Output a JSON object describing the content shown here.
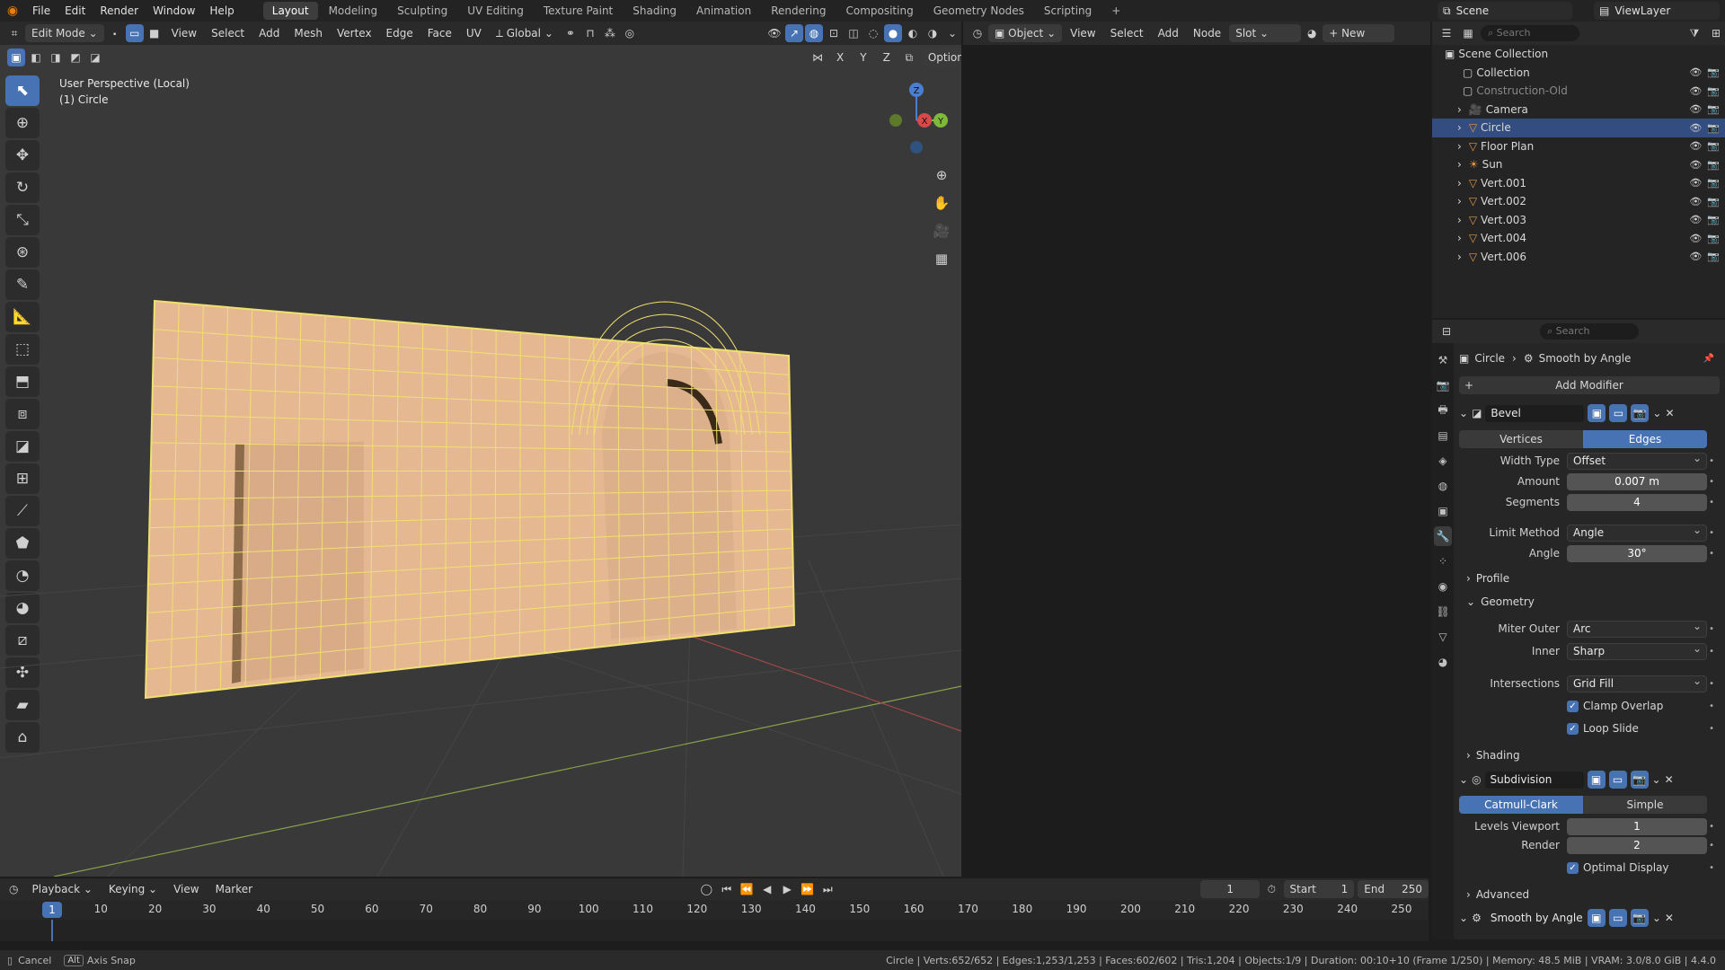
{
  "topbar": {
    "menus": [
      "File",
      "Edit",
      "Render",
      "Window",
      "Help"
    ],
    "workspaces": [
      "Layout",
      "Modeling",
      "Sculpting",
      "UV Editing",
      "Texture Paint",
      "Shading",
      "Animation",
      "Rendering",
      "Compositing",
      "Geometry Nodes",
      "Scripting"
    ],
    "active_workspace": "Layout",
    "scene": "Scene",
    "view_layer": "ViewLayer"
  },
  "viewport": {
    "mode": "Edit Mode",
    "menus": [
      "View",
      "Select",
      "Add",
      "Mesh",
      "Vertex",
      "Edge",
      "Face",
      "UV"
    ],
    "transform_orientation": "Global",
    "axes": [
      "X",
      "Y",
      "Z"
    ],
    "options_label": "Options",
    "perspective": "User Perspective (Local)",
    "object_label": "(1) Circle",
    "gizmo_labels": {
      "z": "Z",
      "x": "X",
      "y": "Y"
    },
    "accent": "#4772b3",
    "mesh_fill": "#e9b98f",
    "mesh_wire": "#f0e070"
  },
  "node_editor": {
    "mode": "Object",
    "menus": [
      "View",
      "Select",
      "Add",
      "Node"
    ],
    "slot": "Slot",
    "new_label": "New"
  },
  "outliner": {
    "search_placeholder": "Search",
    "root": "Scene Collection",
    "rows": [
      {
        "name": "Collection",
        "icon": "collection-icon",
        "selected": false
      },
      {
        "name": "Construction-Old",
        "icon": "collection-icon",
        "selected": false
      },
      {
        "name": "Camera",
        "icon": "camera-icon",
        "selected": false
      },
      {
        "name": "Circle",
        "icon": "mesh-icon",
        "selected": true
      },
      {
        "name": "Floor Plan",
        "icon": "mesh-icon",
        "selected": false
      },
      {
        "name": "Sun",
        "icon": "light-icon",
        "selected": false
      },
      {
        "name": "Vert.001",
        "icon": "mesh-icon",
        "selected": false
      },
      {
        "name": "Vert.002",
        "icon": "mesh-icon",
        "selected": false
      },
      {
        "name": "Vert.003",
        "icon": "mesh-icon",
        "selected": false
      },
      {
        "name": "Vert.004",
        "icon": "mesh-icon",
        "selected": false
      },
      {
        "name": "Vert.006",
        "icon": "mesh-icon",
        "selected": false
      }
    ]
  },
  "properties": {
    "search_placeholder": "Search",
    "breadcrumb_object": "Circle",
    "breadcrumb_modifier": "Smooth by Angle",
    "add_modifier": "Add Modifier",
    "bevel": {
      "name": "Bevel",
      "affect": [
        "Vertices",
        "Edges"
      ],
      "affect_active": "Edges",
      "width_type_label": "Width Type",
      "width_type": "Offset",
      "amount_label": "Amount",
      "amount": "0.007 m",
      "segments_label": "Segments",
      "segments": "4",
      "limit_method_label": "Limit Method",
      "limit_method": "Angle",
      "angle_label": "Angle",
      "angle": "30°",
      "profile": "Profile",
      "geometry": "Geometry",
      "miter_outer_label": "Miter Outer",
      "miter_outer": "Arc",
      "inner_label": "Inner",
      "inner": "Sharp",
      "intersections_label": "Intersections",
      "intersections": "Grid Fill",
      "clamp_overlap": "Clamp Overlap",
      "loop_slide": "Loop Slide",
      "shading": "Shading"
    },
    "subdivision": {
      "name": "Subdivision",
      "types": [
        "Catmull-Clark",
        "Simple"
      ],
      "type_active": "Catmull-Clark",
      "levels_viewport_label": "Levels Viewport",
      "levels_viewport": "1",
      "render_label": "Render",
      "render": "2",
      "optimal_display": "Optimal Display",
      "advanced": "Advanced"
    },
    "smooth": {
      "name": "Smooth by Angle"
    }
  },
  "timeline": {
    "menus": [
      "Playback",
      "Keying",
      "View",
      "Marker"
    ],
    "current_frame": "1",
    "start_label": "Start",
    "start": "1",
    "end_label": "End",
    "end": "250",
    "ticks": [
      "10",
      "20",
      "30",
      "40",
      "50",
      "60",
      "70",
      "80",
      "90",
      "100",
      "110",
      "120",
      "130",
      "140",
      "150",
      "160",
      "170",
      "180",
      "190",
      "200",
      "210",
      "220",
      "230",
      "240",
      "250"
    ],
    "playhead": "1"
  },
  "statusbar": {
    "cancel": "Cancel",
    "alt_key": "Alt",
    "axis_snap": "Axis Snap",
    "stats": "Circle | Verts:652/652 | Edges:1,253/1,253 | Faces:602/602 | Tris:1,204 | Objects:1/9 | Duration: 00:10+10 (Frame 1/250) | Memory: 48.5 MiB | VRAM: 3.0/8.0 GiB | 4.4.0"
  }
}
